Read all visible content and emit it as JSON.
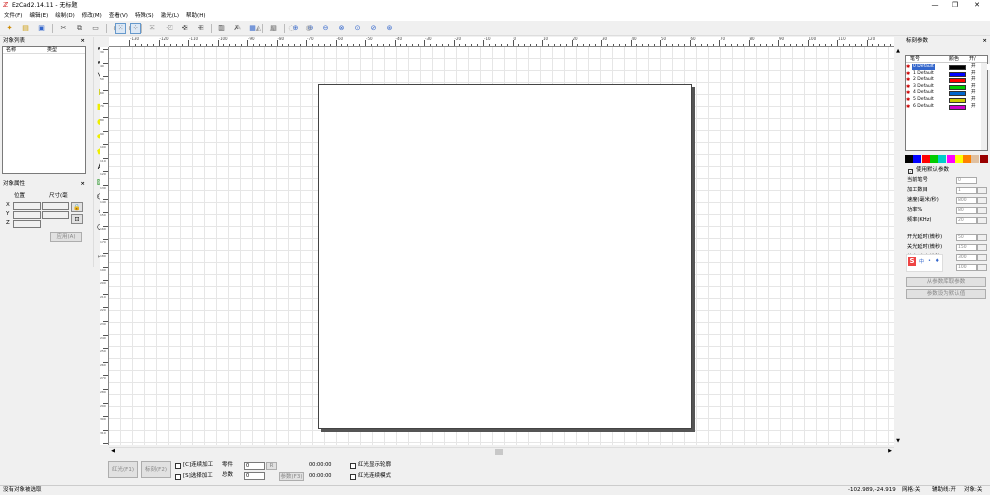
{
  "window": {
    "title": "EzCad2.14.11 - 无标题",
    "minimize": "—",
    "maximize": "❐",
    "close": "✕"
  },
  "menu": [
    "文件(F)",
    "编辑(E)",
    "绘制(D)",
    "修改(M)",
    "查看(V)",
    "特殊(S)",
    "激光(L)",
    "帮助(H)"
  ],
  "object_list": {
    "title": "对象列表",
    "close": "×",
    "col_name": "名称",
    "col_type": "类型"
  },
  "object_props": {
    "title": "对象属性",
    "close": "×",
    "pos_label": "位置",
    "size_label": "尺寸(毫",
    "x": "X",
    "y": "Y",
    "z": "Z",
    "apply": "应用(A)"
  },
  "ruler_h": [
    "-130",
    "-120",
    "-110",
    "-100",
    "-90",
    "-80",
    "-70",
    "-60",
    "-50",
    "-40",
    "-30",
    "-20",
    "-10",
    "0",
    "10",
    "20",
    "30",
    "40",
    "50",
    "60",
    "70",
    "80",
    "90",
    "100",
    "110",
    "120",
    "130",
    "140"
  ],
  "ruler_v": [
    "30",
    "40",
    "50",
    "60",
    "70",
    "80",
    "90",
    "100",
    "110",
    "120",
    "130",
    "140",
    "150",
    "160",
    "170",
    "180",
    "190",
    "200",
    "210",
    "220",
    "230",
    "240",
    "250",
    "260",
    "270",
    "280",
    "290",
    "300",
    "310",
    "320"
  ],
  "bottom": {
    "red_btn": "红光(F1)",
    "mark_btn": "标刻(F2)",
    "cont_label": "[C]连续加工",
    "sel_label": "[S]选择加工",
    "parts_label": "零件",
    "parts_val": "0",
    "total_label": "总数",
    "total_val": "0",
    "reset_btn": "R",
    "param_btn": "参数(F3)",
    "time1": "00:00:00",
    "time2": "00:00:00",
    "outline_label": "红光显示轮廓",
    "cont_red_label": "红光连续模式"
  },
  "status": {
    "left": "没有对象被选取",
    "coords": "-102.989,-24.919",
    "grid": "网格:关",
    "guide": "辅助线:开",
    "snap": "对象:关"
  },
  "mark_params": {
    "title": "标刻参数",
    "close": "×",
    "col_pen": "笔号",
    "col_color": "颜色",
    "col_on": "开/",
    "pens": [
      {
        "label": "0 Default",
        "color": "#000000",
        "on": "开"
      },
      {
        "label": "1 Default",
        "color": "#0000ff",
        "on": "开"
      },
      {
        "label": "2 Default",
        "color": "#ff0000",
        "on": "开"
      },
      {
        "label": "3 Default",
        "color": "#00cc00",
        "on": "开"
      },
      {
        "label": "4 Default",
        "color": "#0066cc",
        "on": "开"
      },
      {
        "label": "5 Default",
        "color": "#cccc00",
        "on": "开"
      },
      {
        "label": "6 Default",
        "color": "#cc00cc",
        "on": "开"
      }
    ],
    "swatches": [
      "#000000",
      "#0000ff",
      "#ff0000",
      "#00cc00",
      "#00cccc",
      "#ff00ff",
      "#ffff00",
      "#ff8000",
      "#e0c0a0",
      "#990000"
    ],
    "use_default": "使用默认参数",
    "fields": [
      {
        "label": "当前笔号",
        "value": "0"
      },
      {
        "label": "加工数目",
        "value": "1"
      },
      {
        "label": "速度(毫米/秒)",
        "value": "800"
      },
      {
        "label": "功率%",
        "value": "80"
      },
      {
        "label": "频率(KHz)",
        "value": "20"
      },
      {
        "label": "开光延时(微秒)",
        "value": "50"
      },
      {
        "label": "关光延时(微秒)",
        "value": "150"
      },
      {
        "label": "结束延时(微秒)",
        "value": "300"
      },
      {
        "label": "拐角延时(微秒)",
        "value": "100"
      }
    ],
    "btn_from_lib": "从参数库取参数",
    "btn_set_default": "参数设为默认值",
    "ime_text": "中"
  }
}
